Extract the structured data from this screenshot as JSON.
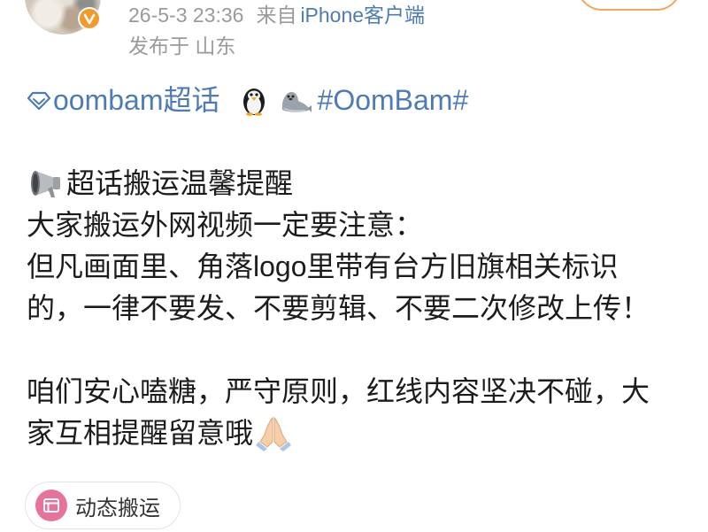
{
  "post_header": {
    "avatar_icon": "avatar-photo",
    "verified_badge_icon": "verified-v-icon",
    "timestamp": "26-5-3 23:36",
    "source_prefix": "来自",
    "source_client": "iPhone客户端",
    "location": "发布于 山东"
  },
  "topic_line": {
    "supertopic_icon": "diamond-icon",
    "supertopic_label": "oombam超话",
    "emoji_icons": [
      "penguin-emoji-icon",
      "seal-emoji-icon"
    ],
    "hashtag": "#OomBam#"
  },
  "notice": {
    "icon": "megaphone-emoji-icon",
    "title": "超话搬运温馨提醒",
    "lines": [
      "大家搬运外网视频一定要注意：",
      "但凡画面里、角落logo里带有台方旧旗相关标识",
      "的，一律不要发、不要剪辑、不要二次修改上传！"
    ]
  },
  "closing": {
    "lines": [
      "咱们安心嗑糖，严守原则，红线内容坚决不碰，大",
      "家互相提醒留意哦"
    ],
    "trailing_icon": "praying-hands-emoji-icon"
  },
  "tag_chip": {
    "icon": "card-layout-icon",
    "label": "动态搬运"
  },
  "colors": {
    "link_blue": "#4c7bb5",
    "meta_gray": "#9a9a9a",
    "body_text": "#1c1c1c",
    "verified_orange": "#f39a2e",
    "chip_icon_pink": "#e8739a",
    "follow_border": "#f5a55a"
  }
}
